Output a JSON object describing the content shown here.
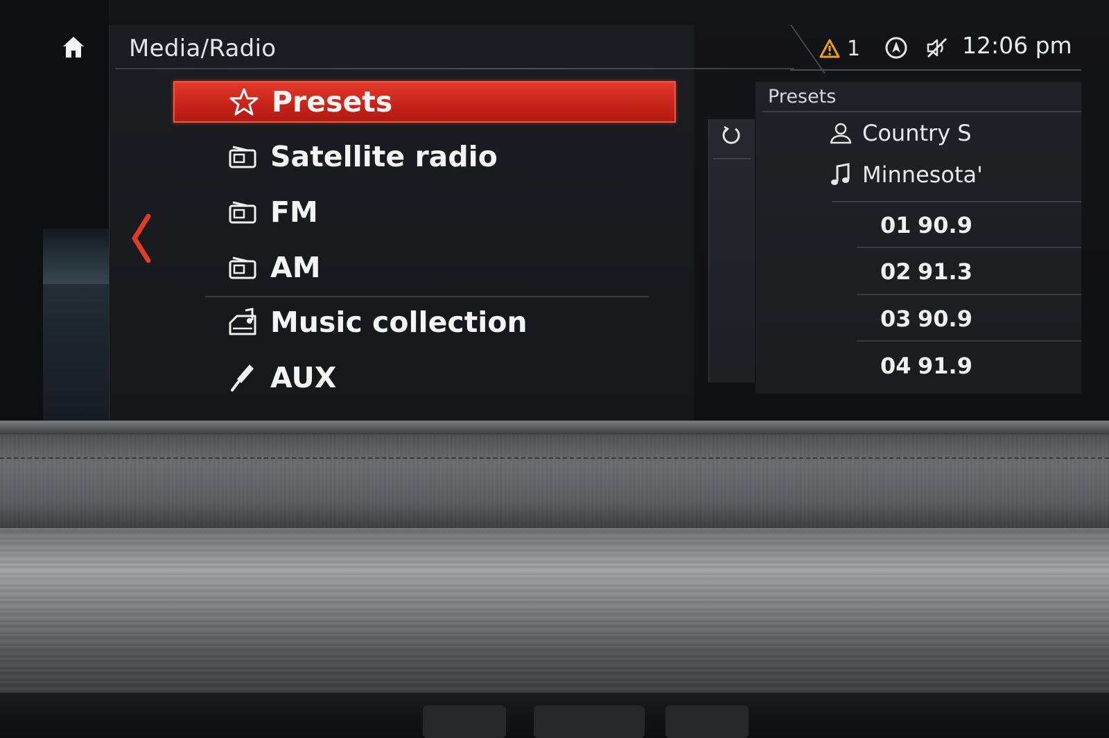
{
  "header": {
    "title": "Media/Radio"
  },
  "status": {
    "warning_count": "1",
    "time": "12:06 pm"
  },
  "menu": {
    "items": [
      {
        "label": "Presets",
        "icon": "star-icon",
        "selected": true
      },
      {
        "label": "Satellite radio",
        "icon": "radio-icon",
        "selected": false
      },
      {
        "label": "FM",
        "icon": "radio-icon",
        "selected": false
      },
      {
        "label": "AM",
        "icon": "radio-icon",
        "selected": false
      },
      {
        "label": "Music collection",
        "icon": "music-collection-icon",
        "selected": false
      },
      {
        "label": "AUX",
        "icon": "aux-plug-icon",
        "selected": false
      }
    ]
  },
  "presets_panel": {
    "title": "Presets",
    "now_playing": {
      "artist": "Country S",
      "track": "Minnesota'"
    },
    "stations": [
      {
        "num": "01",
        "freq": "90.9"
      },
      {
        "num": "02",
        "freq": "91.3"
      },
      {
        "num": "03",
        "freq": "90.9"
      },
      {
        "num": "04",
        "freq": "91.9"
      }
    ]
  },
  "colors": {
    "accent_red": "#d42a1e",
    "warning_orange": "#f0a020"
  }
}
